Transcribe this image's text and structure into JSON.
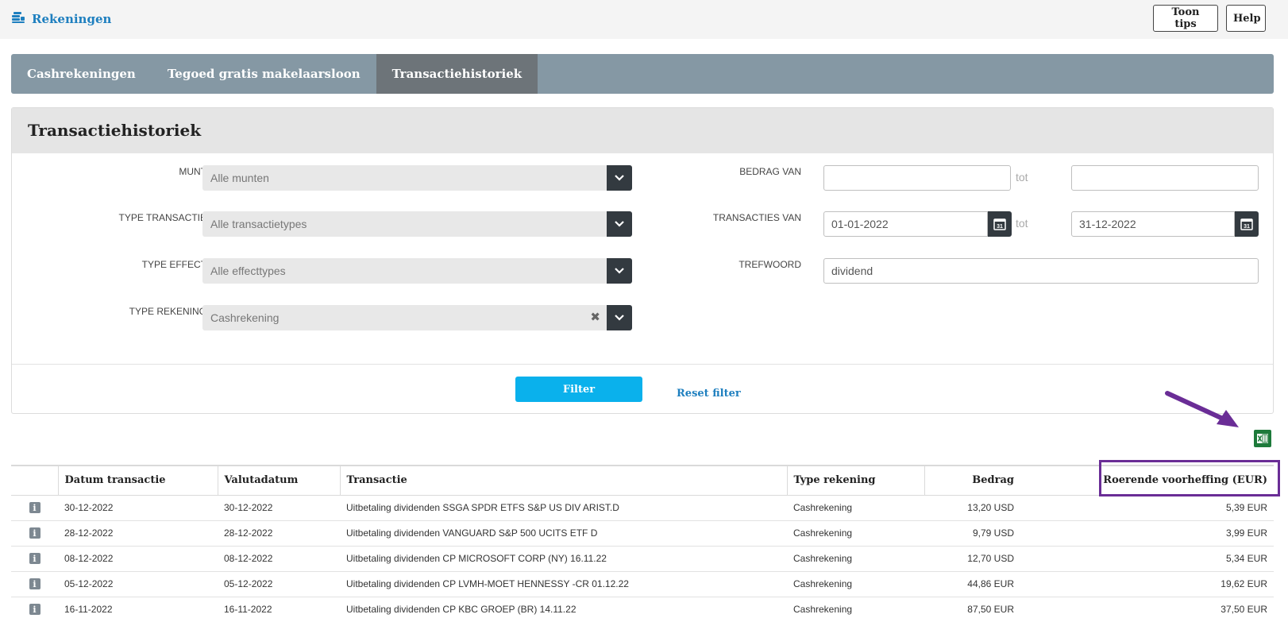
{
  "header": {
    "title": "Rekeningen",
    "icon": "coins-icon",
    "btn_tips": "Toon tips",
    "btn_help": "Help"
  },
  "tabs": [
    {
      "label": "Cashrekeningen",
      "active": false
    },
    {
      "label": "Tegoed gratis makelaarsloon",
      "active": false
    },
    {
      "label": "Transactiehistoriek",
      "active": true
    }
  ],
  "panel": {
    "title": "Transactiehistoriek"
  },
  "filters": {
    "munt": {
      "label": "MUNT",
      "value": "Alle munten"
    },
    "type_transactie": {
      "label": "TYPE TRANSACTIE",
      "value": "Alle transactietypes"
    },
    "type_effect": {
      "label": "TYPE EFFECT",
      "value": "Alle effecttypes"
    },
    "type_rekening": {
      "label": "TYPE REKENING",
      "value": "Cashrekening"
    },
    "bedrag": {
      "label": "BEDRAG VAN",
      "from": "",
      "to": "",
      "sep": "tot"
    },
    "transacties": {
      "label": "TRANSACTIES VAN",
      "from": "01-01-2022",
      "to": "31-12-2022",
      "sep": "tot",
      "cal_day": "31"
    },
    "trefwoord": {
      "label": "TREFWOORD",
      "value": "dividend"
    }
  },
  "actions": {
    "filter": "Filter",
    "reset": "Reset filter"
  },
  "table": {
    "headers": [
      "Datum transactie",
      "Valutadatum",
      "Transactie",
      "Type rekening",
      "Bedrag",
      "Roerende voorheffing (EUR)"
    ],
    "rows": [
      [
        "30-12-2022",
        "30-12-2022",
        "Uitbetaling dividenden SSGA SPDR ETFS S&P US DIV ARIST.D",
        "Cashrekening",
        "13,20 USD",
        "5,39 EUR"
      ],
      [
        "28-12-2022",
        "28-12-2022",
        "Uitbetaling dividenden VANGUARD S&P 500 UCITS ETF D",
        "Cashrekening",
        "9,79 USD",
        "3,99 EUR"
      ],
      [
        "08-12-2022",
        "08-12-2022",
        "Uitbetaling dividenden CP MICROSOFT CORP (NY) 16.11.22",
        "Cashrekening",
        "12,70 USD",
        "5,34 EUR"
      ],
      [
        "05-12-2022",
        "05-12-2022",
        "Uitbetaling dividenden CP LVMH-MOET HENNESSY -CR 01.12.22",
        "Cashrekening",
        "44,86 EUR",
        "19,62 EUR"
      ],
      [
        "16-11-2022",
        "16-11-2022",
        "Uitbetaling dividenden CP KBC GROEP (BR) 14.11.22",
        "Cashrekening",
        "87,50 EUR",
        "37,50 EUR"
      ]
    ]
  },
  "colors": {
    "accent": "#1e7fbf",
    "filter_btn": "#0ab1ec",
    "tabbar": "#8598a4",
    "annotation": "#6a2d96",
    "excel": "#1d7a3a"
  },
  "excel_icon": "excel-export-icon"
}
